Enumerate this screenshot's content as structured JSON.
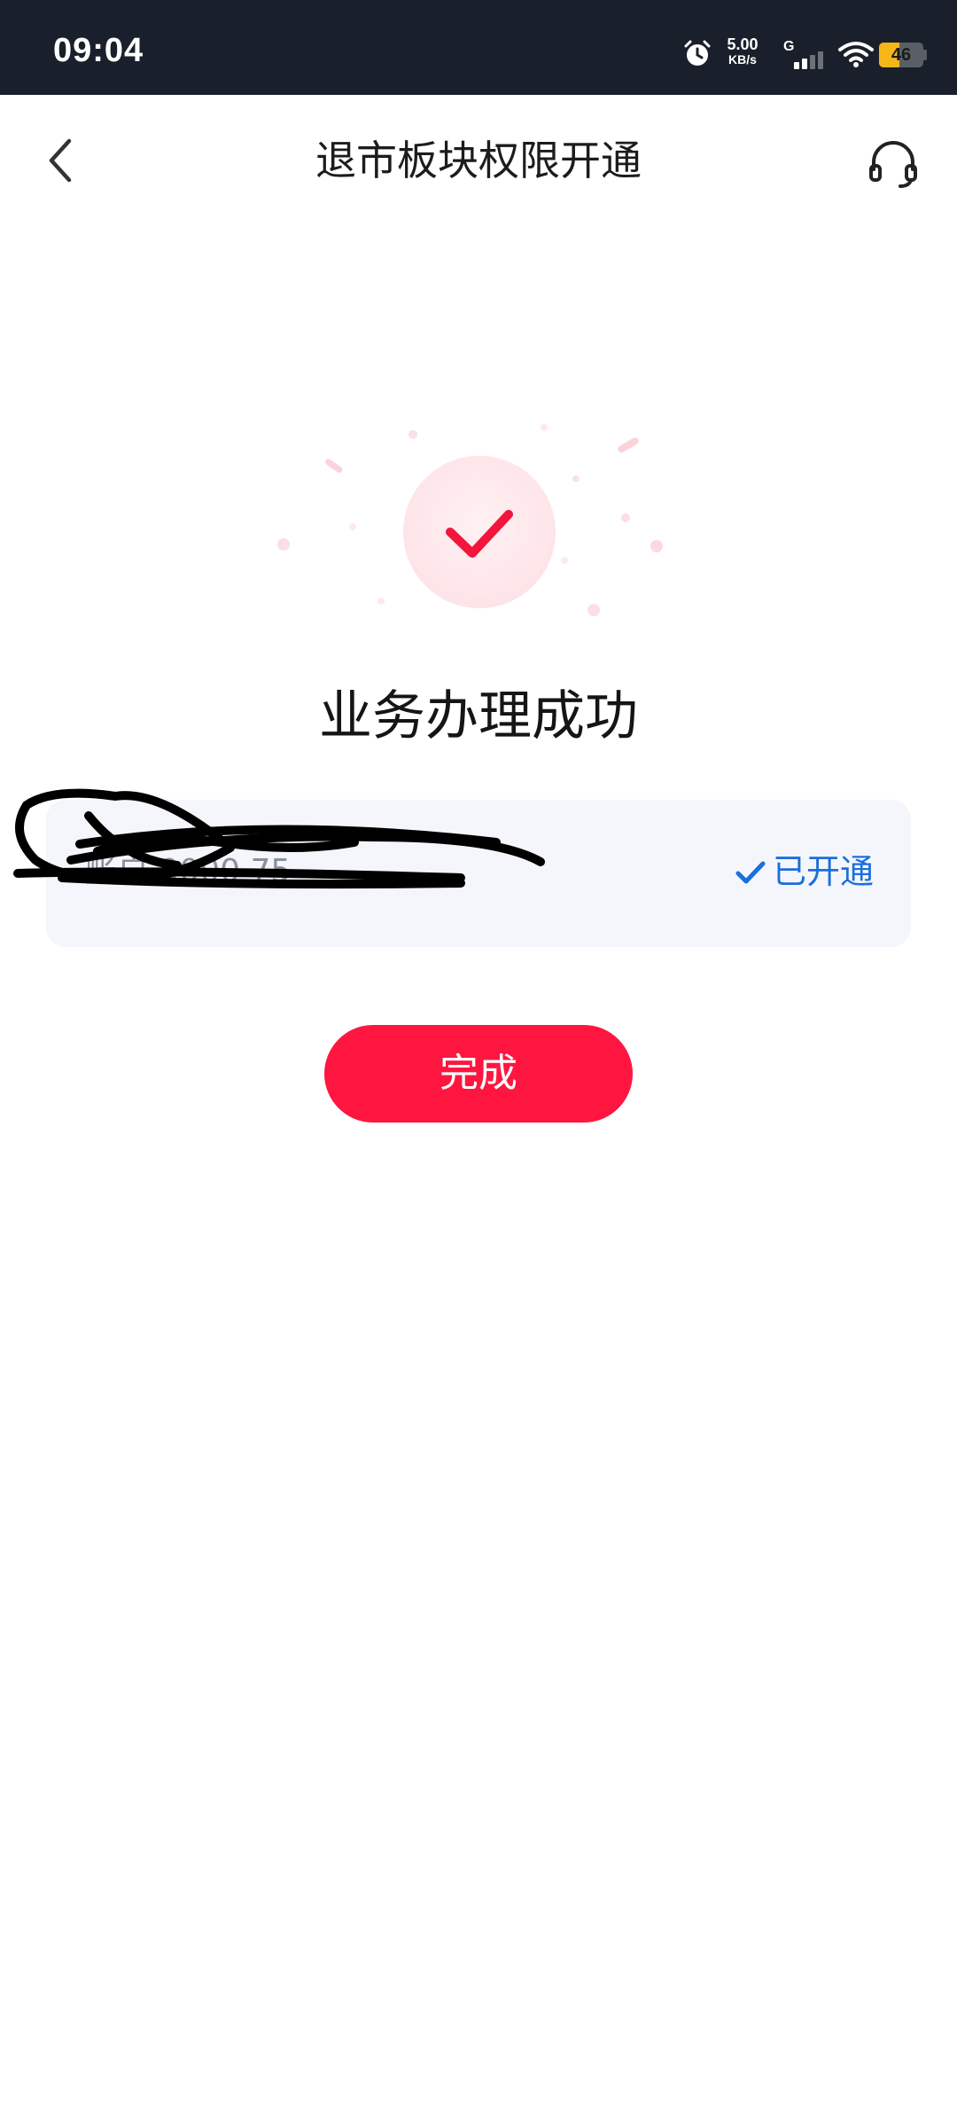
{
  "status_bar": {
    "time": "09:04",
    "net_speed_value": "5.00",
    "net_speed_unit": "KB/s",
    "network_type": "G",
    "battery_level": "46",
    "battery_fraction": 0.46,
    "icons": [
      "alarm-icon",
      "signal-icon",
      "wifi-icon",
      "battery-icon"
    ]
  },
  "header": {
    "title": "退市板块权限开通",
    "back_icon": "chevron-left-icon",
    "service_icon": "headset-icon"
  },
  "result": {
    "icon": "success-check-icon",
    "title": "业务办理成功"
  },
  "account": {
    "masked_text": "账户 0000 75",
    "status_label": "已开通"
  },
  "actions": {
    "done_label": "完成"
  },
  "colors": {
    "accent_red": "#fe1641",
    "status_blue": "#1b6fdb",
    "status_bar_bg": "#1a202b",
    "card_bg": "#f5f6fc"
  }
}
